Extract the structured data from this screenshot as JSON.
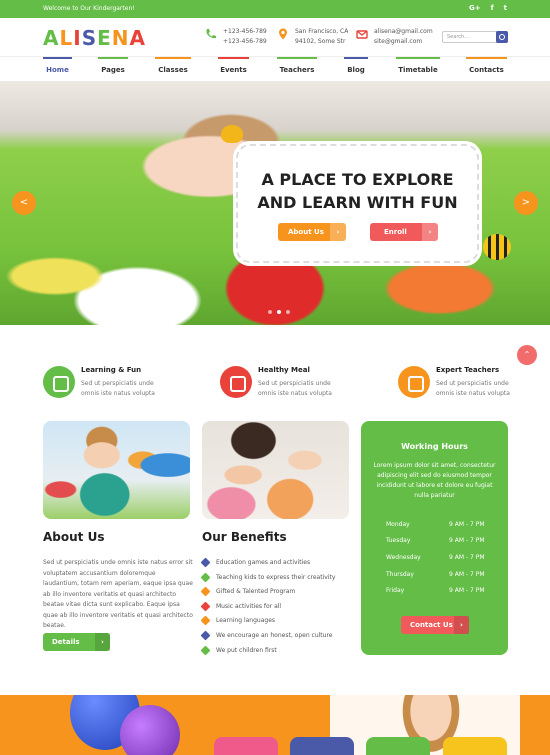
{
  "topbar": {
    "welcome": "Welcome to Our Kindergarten!",
    "social": [
      "G+",
      "f",
      "t"
    ]
  },
  "header": {
    "logo_letters": [
      "A",
      "L",
      "I",
      "S",
      "E",
      "N",
      "A"
    ],
    "logo_colors": [
      "#63bd46",
      "#f7941d",
      "#e9423a",
      "#4b5aa8",
      "#63bd46",
      "#f7941d",
      "#e9423a"
    ],
    "phone": {
      "line1": "+123-456-789",
      "line2": "+123-456-789"
    },
    "address": {
      "line1": "San Francisco, CA",
      "line2": "94102, Some Str"
    },
    "email": {
      "line1": "alisena@gmail.com",
      "line2": "site@gmail.com"
    },
    "search_placeholder": "Search..."
  },
  "nav": [
    {
      "label": "Home",
      "color": "#4b5aa8"
    },
    {
      "label": "Pages",
      "color": "#63bd46"
    },
    {
      "label": "Classes",
      "color": "#f7941d"
    },
    {
      "label": "Events",
      "color": "#e9423a"
    },
    {
      "label": "Teachers",
      "color": "#63bd46"
    },
    {
      "label": "Blog",
      "color": "#4b5aa8"
    },
    {
      "label": "Timetable",
      "color": "#63bd46"
    },
    {
      "label": "Contacts",
      "color": "#f7941d"
    }
  ],
  "hero": {
    "title_line1": "A PLACE TO EXPLORE",
    "title_line2": "AND LEARN WITH FUN",
    "btn_about": "About Us",
    "btn_enroll": "Enroll",
    "prev": "<",
    "next": ">"
  },
  "features": [
    {
      "title": "Learning & Fun",
      "desc1": "Sed ut perspiciatis unde",
      "desc2": "omnis iste natus volupta",
      "color": "#63bd46"
    },
    {
      "title": "Healthy Meal",
      "desc1": "Sed ut perspiciatis unde",
      "desc2": "omnis iste natus volupta",
      "color": "#e9423a"
    },
    {
      "title": "Expert Teachers",
      "desc1": "Sed ut perspiciatis unde",
      "desc2": "omnis iste natus volupta",
      "color": "#f7941d"
    }
  ],
  "hours": {
    "title": "Working Hours",
    "desc": "Lorem ipsum dolor sit amet, consectetur adipiscing elit sed do eiusmod tempor incididunt ut labore et dolore eu fugiat nulla pariatur",
    "rows": [
      {
        "day": "Monday",
        "time": "9 AM - 7 PM"
      },
      {
        "day": "Tuesday",
        "time": "9 AM - 7 PM"
      },
      {
        "day": "Wednesday",
        "time": "9 AM - 7 PM"
      },
      {
        "day": "Thursday",
        "time": "9 AM - 7 PM"
      },
      {
        "day": "Friday",
        "time": "9 AM - 7 PM"
      }
    ],
    "btn": "Contact Us"
  },
  "about": {
    "title": "About Us",
    "text": "Sed ut perspiciatis unde omnis iste natus error sit voluptatem accusantium doloremque laudantium, totam rem aperiam, eaque ipsa quae ab illo inventore veritatis et quasi architecto beatae vitae dicta sunt explicabo. Eaque ipsa quae ab illo inventore veritatis et quasi architecto beatae.",
    "btn": "Details"
  },
  "benefits": {
    "title": "Our Benefits",
    "items": [
      "Education games and activities",
      "Teaching kids to express their creativity",
      "Gifted & Talented Program",
      "Music activities for all",
      "Learning languages",
      "We encourage an honest, open culture",
      "We put children first"
    ],
    "colors": [
      "#4b5aa8",
      "#63bd46",
      "#f7941d",
      "#e9423a",
      "#f7941d",
      "#4b5aa8",
      "#63bd46"
    ]
  },
  "colors": {
    "green": "#63bd46",
    "orange": "#f7941d",
    "red": "#e9423a",
    "blue": "#4b5aa8"
  }
}
